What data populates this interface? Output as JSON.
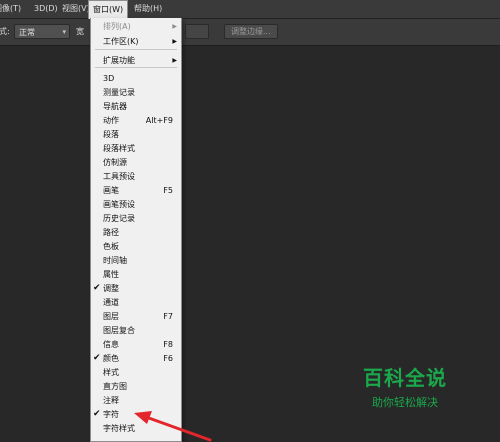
{
  "menubar": {
    "items": [
      "图像(T)",
      "3D(D)",
      "视图(V)",
      "窗口(W)",
      "帮助(H)"
    ]
  },
  "options_bar": {
    "style_label": "式:",
    "style_value": "正常",
    "width_label": "宽",
    "adjust_button": "调整边缘..."
  },
  "window_menu": {
    "items": [
      {
        "label": "排列(A)",
        "shortcut": "",
        "submenu": true,
        "checked": false,
        "disabled": true
      },
      {
        "label": "工作区(K)",
        "shortcut": "",
        "submenu": true,
        "checked": false,
        "disabled": false
      },
      {
        "label": "扩展功能",
        "shortcut": "",
        "submenu": true,
        "checked": false,
        "disabled": false
      },
      {
        "label": "3D",
        "shortcut": "",
        "submenu": false,
        "checked": false,
        "disabled": false
      },
      {
        "label": "测量记录",
        "shortcut": "",
        "submenu": false,
        "checked": false,
        "disabled": false
      },
      {
        "label": "导航器",
        "shortcut": "",
        "submenu": false,
        "checked": false,
        "disabled": false
      },
      {
        "label": "动作",
        "shortcut": "Alt+F9",
        "submenu": false,
        "checked": false,
        "disabled": false
      },
      {
        "label": "段落",
        "shortcut": "",
        "submenu": false,
        "checked": false,
        "disabled": false
      },
      {
        "label": "段落样式",
        "shortcut": "",
        "submenu": false,
        "checked": false,
        "disabled": false
      },
      {
        "label": "仿制源",
        "shortcut": "",
        "submenu": false,
        "checked": false,
        "disabled": false
      },
      {
        "label": "工具预设",
        "shortcut": "",
        "submenu": false,
        "checked": false,
        "disabled": false
      },
      {
        "label": "画笔",
        "shortcut": "F5",
        "submenu": false,
        "checked": false,
        "disabled": false
      },
      {
        "label": "画笔预设",
        "shortcut": "",
        "submenu": false,
        "checked": false,
        "disabled": false
      },
      {
        "label": "历史记录",
        "shortcut": "",
        "submenu": false,
        "checked": false,
        "disabled": false
      },
      {
        "label": "路径",
        "shortcut": "",
        "submenu": false,
        "checked": false,
        "disabled": false
      },
      {
        "label": "色板",
        "shortcut": "",
        "submenu": false,
        "checked": false,
        "disabled": false
      },
      {
        "label": "时间轴",
        "shortcut": "",
        "submenu": false,
        "checked": false,
        "disabled": false
      },
      {
        "label": "属性",
        "shortcut": "",
        "submenu": false,
        "checked": false,
        "disabled": false
      },
      {
        "label": "调整",
        "shortcut": "",
        "submenu": false,
        "checked": true,
        "disabled": false
      },
      {
        "label": "通道",
        "shortcut": "",
        "submenu": false,
        "checked": false,
        "disabled": false
      },
      {
        "label": "图层",
        "shortcut": "F7",
        "submenu": false,
        "checked": false,
        "disabled": false
      },
      {
        "label": "图层复合",
        "shortcut": "",
        "submenu": false,
        "checked": false,
        "disabled": false
      },
      {
        "label": "信息",
        "shortcut": "F8",
        "submenu": false,
        "checked": false,
        "disabled": false
      },
      {
        "label": "颜色",
        "shortcut": "F6",
        "submenu": false,
        "checked": true,
        "disabled": false
      },
      {
        "label": "样式",
        "shortcut": "",
        "submenu": false,
        "checked": false,
        "disabled": false
      },
      {
        "label": "直方图",
        "shortcut": "",
        "submenu": false,
        "checked": false,
        "disabled": false
      },
      {
        "label": "注释",
        "shortcut": "",
        "submenu": false,
        "checked": false,
        "disabled": false
      },
      {
        "label": "字符",
        "shortcut": "",
        "submenu": false,
        "checked": true,
        "disabled": false
      },
      {
        "label": "字符样式",
        "shortcut": "",
        "submenu": false,
        "checked": false,
        "disabled": false
      }
    ]
  },
  "watermark": {
    "title": "百科全说",
    "subtitle": "助你轻松解决"
  },
  "colors": {
    "accent_arrow": "#e3262b",
    "watermark_green": "#1aa84b"
  }
}
